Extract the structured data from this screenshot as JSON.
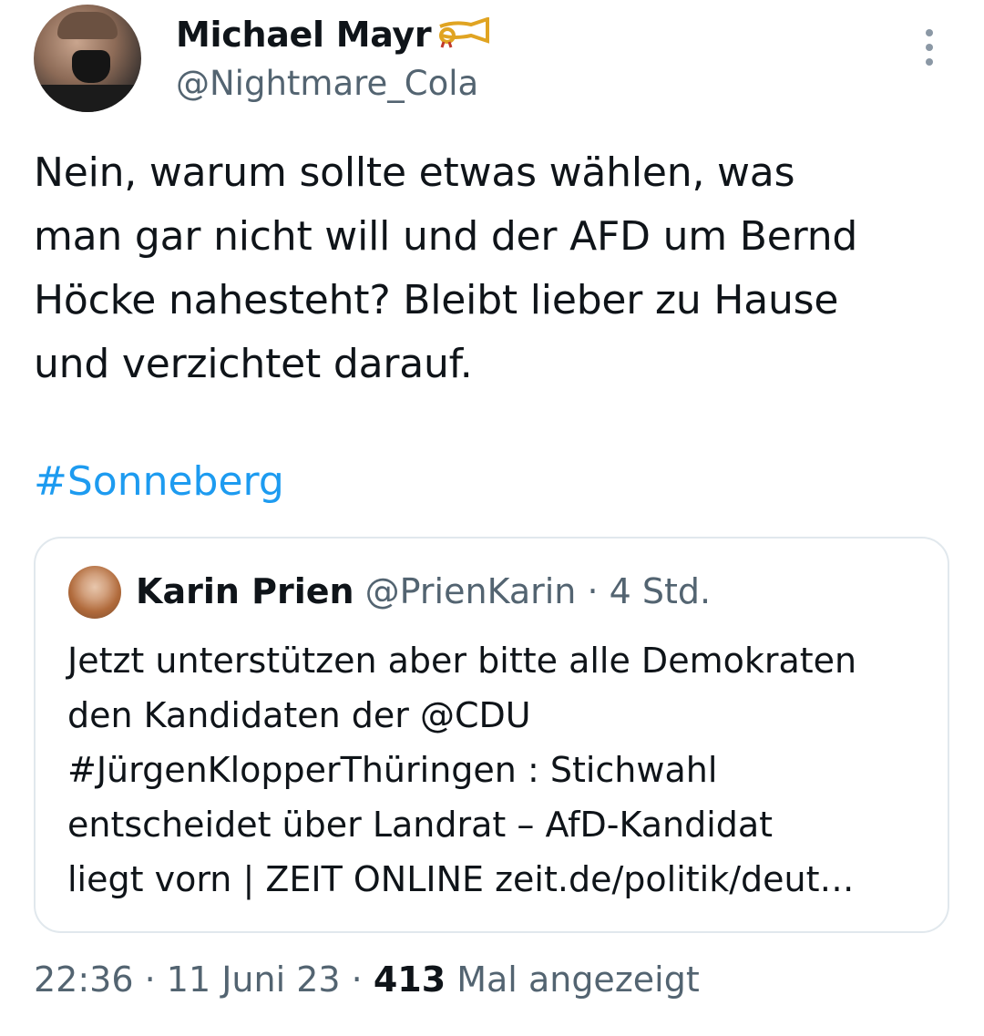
{
  "author": {
    "name": "Michael Mayr",
    "handle": "@Nightmare_Cola",
    "badge_icon": "postal-horn-icon"
  },
  "tweet": {
    "lines": [
      "Nein, warum sollte etwas wählen, was",
      "man gar nicht will und der AFD um Bernd",
      "Höcke nahesteht? Bleibt lieber zu Hause",
      "und verzichtet darauf."
    ],
    "hashtag": "#Sonneberg"
  },
  "quoted_tweet": {
    "name": "Karin Prien",
    "handle": "@PrienKarin",
    "separator": " · ",
    "time": "4 Std.",
    "lines": [
      "Jetzt unterstützen aber bitte alle Demokraten",
      "den Kandidaten der @CDU",
      "#JürgenKlopperThüringen : Stichwahl",
      "entscheidet über Landrat – AfD-Kandidat",
      "liegt vorn | ZEIT ONLINE zeit.de/politik/deut…"
    ]
  },
  "footer": {
    "time": "22:36",
    "sep1": " · ",
    "date": "11 Juni 23",
    "sep2": " · ",
    "views_count": "413",
    "views_label": " Mal angezeigt"
  },
  "colors": {
    "accent": "#1d9bf0",
    "secondary_text": "#536471",
    "border": "#e1e8ed"
  }
}
